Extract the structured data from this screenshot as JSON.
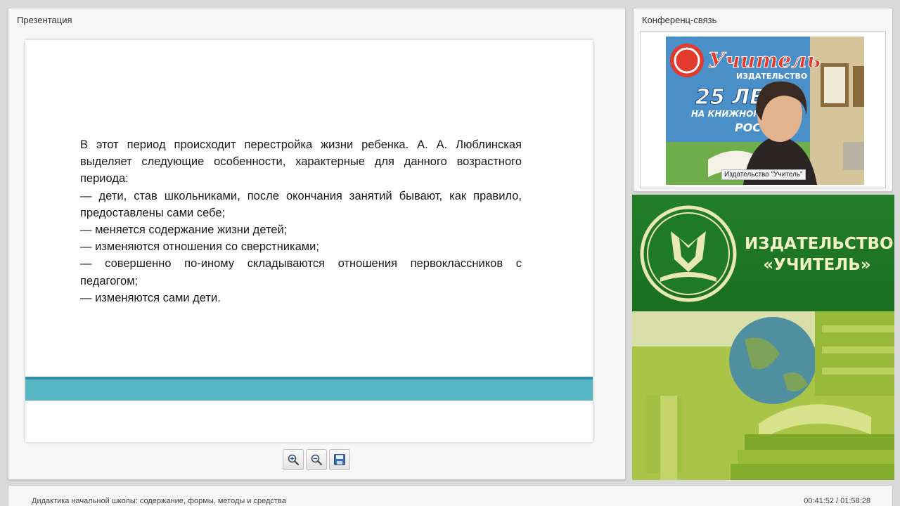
{
  "presentation": {
    "title": "Презентация",
    "slide_paragraphs": [
      "В этот период происходит перестройка жизни ребенка. А. А. Люблинская выделяет следующие особенности, характерные для данного возрастного периода:",
      "— дети, став школьниками, после окончания занятий бывают, как правило, предоставлены сами себе;",
      "— меняется содержание жизни детей;",
      "— изменяются отношения со сверстниками;",
      "— совершенно по-иному складываются отношения первоклассников с педагогом;",
      "— изменяются сами дети."
    ],
    "toolbar": {
      "zoom_in": "zoom-in-icon",
      "zoom_out": "zoom-out-icon",
      "save": "save-icon"
    },
    "colors": {
      "band_dark": "#2f8fa8",
      "band_light": "#56b7c3"
    }
  },
  "conference": {
    "title": "Конференц-связь",
    "video_label": "Издательство \"Учитель\"",
    "backdrop": {
      "brand": "Учитель",
      "sub": "ИЗДАТЕЛЬСТВО",
      "years": "25 ЛЕТ",
      "line1": "НА КНИЖНОМ РЫ",
      "line2": "РОСС"
    }
  },
  "banner": {
    "line1": "ИЗДАТЕЛЬСТВО",
    "line2": "«УЧИТЕЛЬ»",
    "colors": {
      "green": "#1c7a23",
      "text": "#f2f2c8"
    }
  },
  "footer": {
    "course_title": "Дидактика начальной школы: содержание, формы, методы и средства",
    "time": "00:41:52 / 01:58:28"
  }
}
